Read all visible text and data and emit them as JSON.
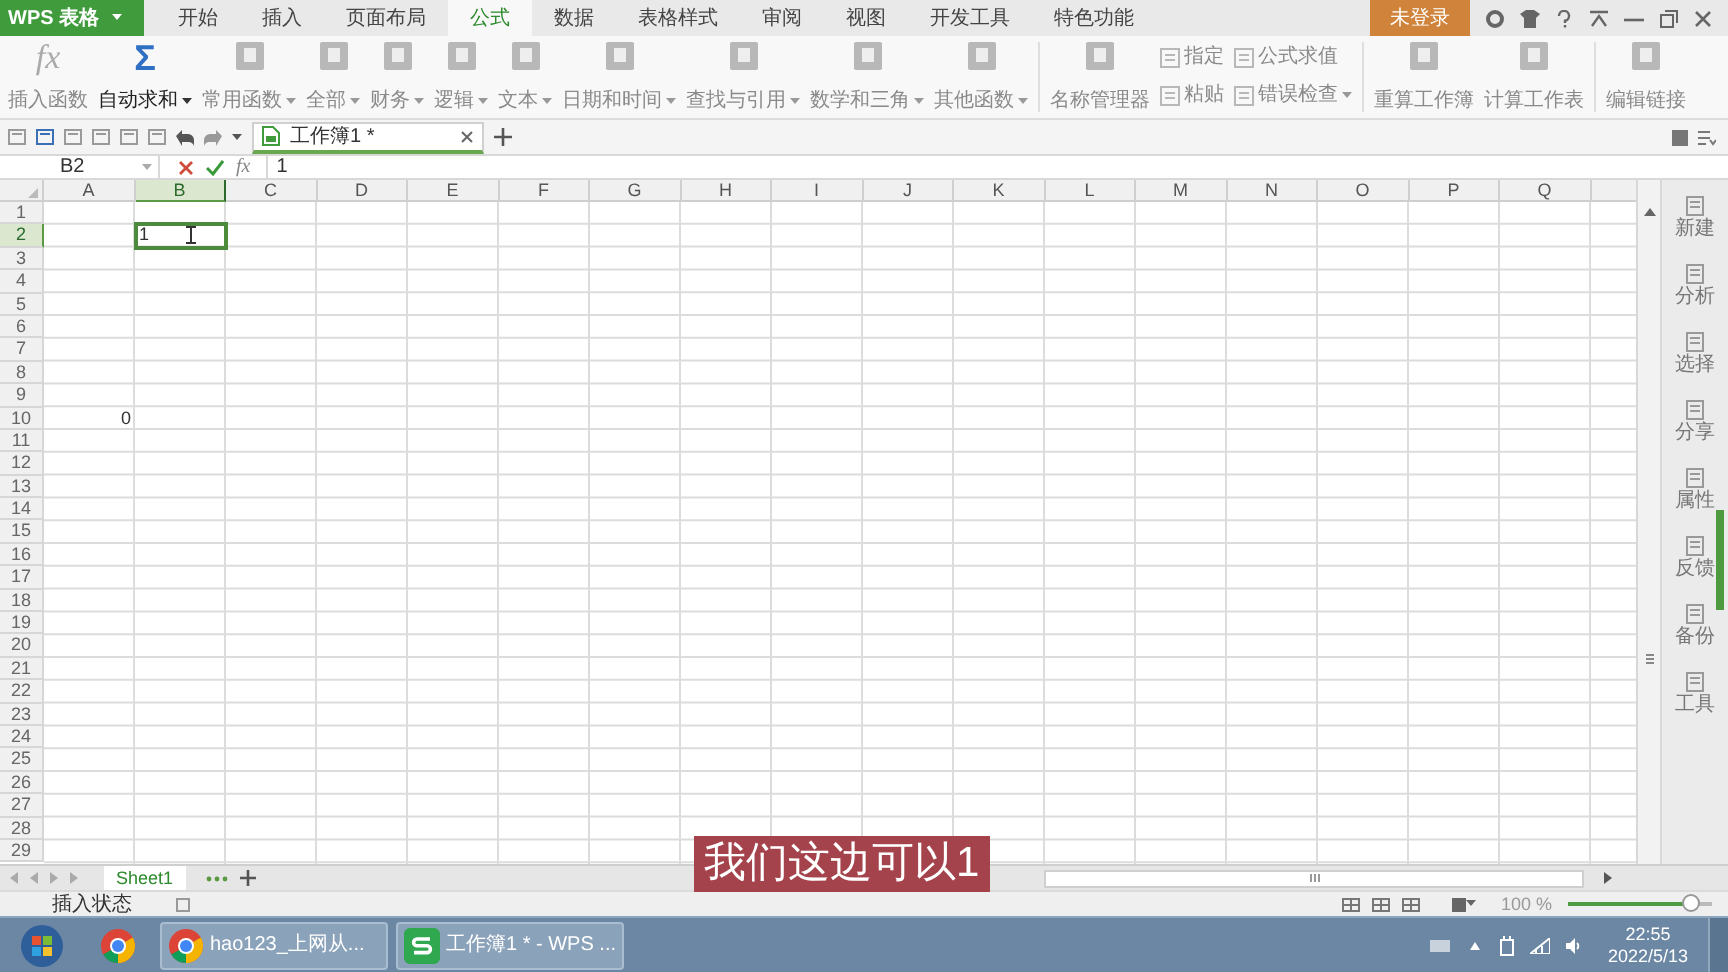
{
  "app_button": {
    "label": "WPS 表格"
  },
  "menu_tabs": [
    {
      "label": "开始",
      "selected": false
    },
    {
      "label": "插入",
      "selected": false
    },
    {
      "label": "页面布局",
      "selected": false
    },
    {
      "label": "公式",
      "selected": true
    },
    {
      "label": "数据",
      "selected": false
    },
    {
      "label": "表格样式",
      "selected": false
    },
    {
      "label": "审阅",
      "selected": false
    },
    {
      "label": "视图",
      "selected": false
    },
    {
      "label": "开发工具",
      "selected": false
    },
    {
      "label": "特色功能",
      "selected": false
    }
  ],
  "login_button": {
    "label": "未登录"
  },
  "ribbon": {
    "groups": [
      {
        "items": [
          {
            "kind": "large",
            "glyph": "fx",
            "label": "插入函数",
            "dropdown": false,
            "disabled": true
          },
          {
            "kind": "large",
            "glyph": "Σ",
            "label": "自动求和",
            "dropdown": true,
            "disabled": false
          },
          {
            "kind": "large",
            "label": "常用函数",
            "dropdown": true,
            "disabled": true
          },
          {
            "kind": "large",
            "label": "全部",
            "dropdown": true,
            "disabled": true
          },
          {
            "kind": "large",
            "label": "财务",
            "dropdown": true,
            "disabled": true
          },
          {
            "kind": "large",
            "label": "逻辑",
            "dropdown": true,
            "disabled": true
          },
          {
            "kind": "large",
            "label": "文本",
            "dropdown": true,
            "disabled": true
          },
          {
            "kind": "large",
            "label": "日期和时间",
            "dropdown": true,
            "disabled": true
          },
          {
            "kind": "large",
            "label": "查找与引用",
            "dropdown": true,
            "disabled": true
          },
          {
            "kind": "large",
            "label": "数学和三角",
            "dropdown": true,
            "disabled": true
          },
          {
            "kind": "large",
            "label": "其他函数",
            "dropdown": true,
            "disabled": true
          }
        ]
      },
      {
        "items": [
          {
            "kind": "large",
            "label": "名称管理器",
            "dropdown": false,
            "disabled": true
          },
          {
            "kind": "stack",
            "items": [
              {
                "label": "指定",
                "dropdown": false,
                "disabled": true
              },
              {
                "label": "粘贴",
                "dropdown": false,
                "disabled": true
              }
            ]
          },
          {
            "kind": "stack",
            "items": [
              {
                "label": "公式求值",
                "dropdown": false,
                "disabled": true
              },
              {
                "label": "错误检查",
                "dropdown": true,
                "disabled": true
              }
            ]
          }
        ]
      },
      {
        "items": [
          {
            "kind": "large",
            "label": "重算工作簿",
            "dropdown": false,
            "disabled": true
          },
          {
            "kind": "large",
            "label": "计算工作表",
            "dropdown": false,
            "disabled": true
          }
        ]
      },
      {
        "items": [
          {
            "kind": "large",
            "label": "编辑链接",
            "dropdown": false,
            "disabled": true
          }
        ]
      }
    ]
  },
  "document_tab": {
    "title": "工作簿1 *"
  },
  "formula_bar": {
    "name_box": "B2",
    "function_glyph": "fx",
    "value": "1"
  },
  "sheet": {
    "columns": [
      {
        "label": "A",
        "selected": false
      },
      {
        "label": "B",
        "selected": true
      },
      {
        "label": "C",
        "selected": false
      },
      {
        "label": "D",
        "selected": false
      },
      {
        "label": "E",
        "selected": false
      },
      {
        "label": "F",
        "selected": false
      },
      {
        "label": "G",
        "selected": false
      },
      {
        "label": "H",
        "selected": false
      },
      {
        "label": "I",
        "selected": false
      },
      {
        "label": "J",
        "selected": false
      },
      {
        "label": "K",
        "selected": false
      },
      {
        "label": "L",
        "selected": false
      },
      {
        "label": "M",
        "selected": false
      },
      {
        "label": "N",
        "selected": false
      },
      {
        "label": "O",
        "selected": false
      },
      {
        "label": "P",
        "selected": false
      },
      {
        "label": "Q",
        "selected": false
      }
    ],
    "rows": [
      {
        "label": "1",
        "selected": false
      },
      {
        "label": "2",
        "selected": true,
        "values": [
          {
            "kind": "empty"
          },
          {
            "kind": "text",
            "text": "1",
            "editing": true
          }
        ]
      },
      {
        "label": "3",
        "selected": false
      },
      {
        "label": "4",
        "selected": false
      },
      {
        "label": "5",
        "selected": false
      },
      {
        "label": "6",
        "selected": false
      },
      {
        "label": "7",
        "selected": false
      },
      {
        "label": "8",
        "selected": false
      },
      {
        "label": "9",
        "selected": false
      },
      {
        "label": "10",
        "selected": false,
        "values": [
          {
            "kind": "text",
            "text": "0",
            "editing": false
          }
        ]
      },
      {
        "label": "11",
        "selected": false
      },
      {
        "label": "12",
        "selected": false
      },
      {
        "label": "13",
        "selected": false
      },
      {
        "label": "14",
        "selected": false
      },
      {
        "label": "15",
        "selected": false
      },
      {
        "label": "16",
        "selected": false
      },
      {
        "label": "17",
        "selected": false
      },
      {
        "label": "18",
        "selected": false
      },
      {
        "label": "19",
        "selected": false
      },
      {
        "label": "20",
        "selected": false
      },
      {
        "label": "21",
        "selected": false
      },
      {
        "label": "22",
        "selected": false
      },
      {
        "label": "23",
        "selected": false
      },
      {
        "label": "24",
        "selected": false
      },
      {
        "label": "25",
        "selected": false
      },
      {
        "label": "26",
        "selected": false
      },
      {
        "label": "27",
        "selected": false
      },
      {
        "label": "28",
        "selected": false
      },
      {
        "label": "29",
        "selected": false
      }
    ]
  },
  "side_panel": [
    {
      "label": "新建"
    },
    {
      "label": "分析"
    },
    {
      "label": "选择"
    },
    {
      "label": "分享"
    },
    {
      "label": "属性"
    },
    {
      "label": "反馈"
    },
    {
      "label": "备份"
    },
    {
      "label": "工具"
    }
  ],
  "sheet_tabs": [
    {
      "label": "Sheet1",
      "selected": true
    }
  ],
  "status_bar": {
    "mode": "插入状态",
    "zoom": "100 %",
    "zoom_slider": {
      "level": 0.85
    }
  },
  "subtitle": {
    "text": "我们这边可以1"
  },
  "taskbar": {
    "windows": [
      {
        "kind": "browser",
        "label": "hao123_上网从..."
      },
      {
        "kind": "spreadsheet",
        "label": "工作簿1 * - WPS ..."
      }
    ],
    "time": "22:55",
    "date": "2022/5/13"
  }
}
